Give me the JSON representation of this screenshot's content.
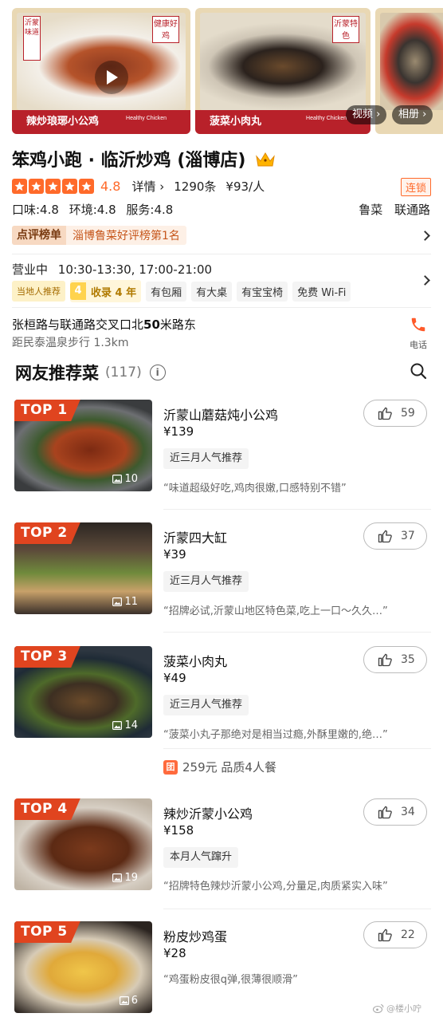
{
  "gallery": {
    "card1": {
      "side_tag": "沂蒙味道",
      "corner_tag": "健康好鸡",
      "banner": "辣炒琅琊小公鸡",
      "healthy": "Healthy Chicken"
    },
    "card2": {
      "corner_tag": "沂蒙特色",
      "banner": "菠菜小肉丸",
      "healthy": "Healthy Chicken"
    },
    "video_label": "视频 ›",
    "album_label": "相册 ›"
  },
  "shop": {
    "name": "笨鸡小跑 · 临沂炒鸡 (淄博店)",
    "score": "4.8",
    "details": "详情 ›",
    "reviews": "1290条",
    "price": "¥93/人",
    "chain": "连锁",
    "taste": "口味:4.8",
    "env": "环境:4.8",
    "service": "服务:4.8",
    "cuisine": "鲁菜",
    "area": "联通路",
    "rank_label": "点评榜单",
    "rank_text": "淄博鲁菜好评榜第1名",
    "status": "营业中",
    "hours": "10:30-13:30, 17:00-21:00",
    "local_tag": "当地人推荐",
    "years_num": "4",
    "years_text": "收录 4 年",
    "facilities": [
      "有包厢",
      "有大桌",
      "有宝宝椅",
      "免费 Wi-Fi"
    ],
    "address_pre": "张桓路与联通路交叉口北",
    "address_bold": "50",
    "address_post": "米路东",
    "walk": "距民泰温泉步行 1.3km",
    "phone_label": "电话"
  },
  "dishes_section": {
    "title": "网友推荐菜",
    "count": "(117)",
    "info": "i"
  },
  "dishes": [
    {
      "rank": "TOP 1",
      "name": "沂蒙山蘑菇炖小公鸡",
      "price": "¥139",
      "tag": "近三月人气推荐",
      "quote": "“味道超级好吃,鸡肉很嫩,口感特别不错”",
      "likes": "59",
      "pics": "10"
    },
    {
      "rank": "TOP 2",
      "name": "沂蒙四大缸",
      "price": "¥39",
      "tag": "近三月人气推荐",
      "quote": "“招牌必试,沂蒙山地区特色菜,吃上一口～久久…”",
      "likes": "37",
      "pics": "11"
    },
    {
      "rank": "TOP 3",
      "name": "菠菜小肉丸",
      "price": "¥49",
      "tag": "近三月人气推荐",
      "quote": "“菠菜小丸子那绝对是相当过瘾,外酥里嫩的,绝…”",
      "likes": "35",
      "pics": "14"
    },
    {
      "rank": "TOP 4",
      "name": "辣炒沂蒙小公鸡",
      "price": "¥158",
      "tag": "本月人气蹿升",
      "quote": "“招牌特色辣炒沂蒙小公鸡,分量足,肉质紧实入味”",
      "likes": "34",
      "pics": "19"
    },
    {
      "rank": "TOP 5",
      "name": "粉皮炒鸡蛋",
      "price": "¥28",
      "tag": "",
      "quote": "“鸡蛋粉皮很q弹,很薄很顺滑”",
      "likes": "22",
      "pics": "6"
    }
  ],
  "deal": {
    "icon": "团",
    "text": "259元 品质4人餐"
  },
  "watermark": "@楼小咛",
  "colors": {
    "accent": "#ff6a2a",
    "top_badge": "#e0441f",
    "banner_red": "#b8212a"
  }
}
